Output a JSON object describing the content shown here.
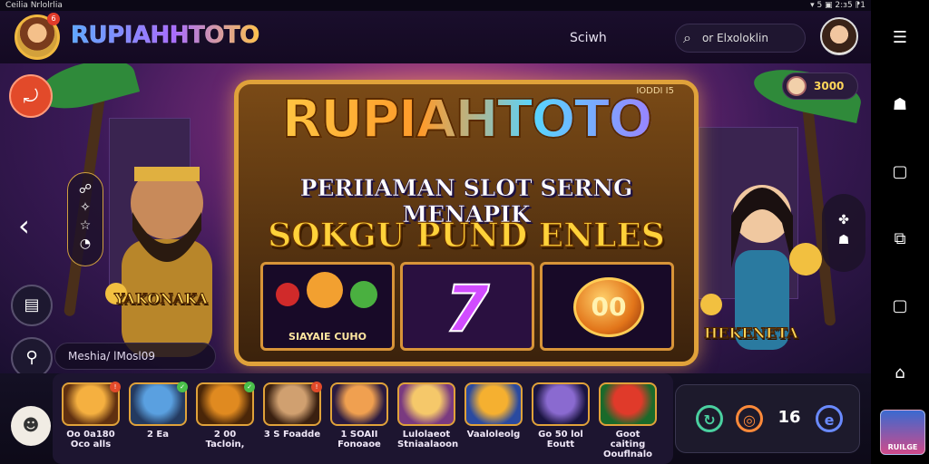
{
  "status_bar": {
    "left_text": "Ceilia Nrlolrlia",
    "right_text": "▾ 5 ▣ 2:ɜ5 ⁋1"
  },
  "header": {
    "logo_text": "RUPIAHHTOTO",
    "logo_badge": "6",
    "search_link": "Sciwh",
    "search_placeholder": "or Elxoloklin"
  },
  "banner": {
    "title": "RUPIAHTOTO",
    "board_tag": "IODDI I5",
    "subtitle1": "PERIIAMAN SLOT SERNG MENAPIK",
    "subtitle2": "SOKGU PUND ENLES",
    "reels": [
      {
        "label": "SIAYAIE CUHO"
      },
      {
        "label": "7"
      },
      {
        "label": "00"
      }
    ],
    "char_left_label": "YAKONAKA",
    "char_right_label": "HEKENETA",
    "coin_amount": "3000",
    "search_strip": "Meshia/ lMosl09",
    "left_panel_icons": [
      "☍",
      "✧",
      "☆",
      "◔"
    ],
    "right_panel_icons": [
      "✤",
      "☗"
    ]
  },
  "games": [
    {
      "name": "Oo 0a180 Oco alls",
      "badge": "!",
      "badge_color": "#e24a2a",
      "colors": [
        "#f5b040",
        "#603010"
      ]
    },
    {
      "name": "2 Ea",
      "badge": "✓",
      "badge_color": "#4ac04a",
      "colors": [
        "#5aa0e0",
        "#243a60"
      ]
    },
    {
      "name": "2 00 Tacloin,",
      "badge": "✓",
      "badge_color": "#4ac04a",
      "colors": [
        "#e08a20",
        "#4a2608"
      ]
    },
    {
      "name": "3 S Foadde",
      "badge": "!",
      "badge_color": "#e24a2a",
      "colors": [
        "#d0a070",
        "#3a2010"
      ]
    },
    {
      "name": "1 SOAII Fonoaoe",
      "badge": "",
      "badge_color": "",
      "colors": [
        "#f0a050",
        "#2a1a40"
      ]
    },
    {
      "name": "Lulolaeot Stniaalaoon",
      "badge": "",
      "badge_color": "",
      "colors": [
        "#f5c86a",
        "#7a3a80"
      ]
    },
    {
      "name": "Vaaloleolg",
      "badge": "",
      "badge_color": "",
      "colors": [
        "#f5b030",
        "#2a4aa0"
      ]
    },
    {
      "name": "Go 50 lol Eoutt",
      "badge": "",
      "badge_color": "",
      "colors": [
        "#8a6ad0",
        "#1a1440"
      ]
    },
    {
      "name": "Goot caiting Oouflnalo",
      "badge": "",
      "badge_color": "",
      "colors": [
        "#e03a2a",
        "#1a6a2a"
      ]
    }
  ],
  "quick_panel": {
    "icons": [
      {
        "name": "refresh-icon",
        "glyph": "↻",
        "color": "#4ad0a0"
      },
      {
        "name": "ring-icon",
        "glyph": "◎",
        "color": "#ff8a3a"
      },
      {
        "name": "counter-icon",
        "glyph": "16",
        "color": "#ffffff"
      },
      {
        "name": "e-icon",
        "glyph": "e",
        "color": "#6a8aff"
      }
    ]
  },
  "sysnav": {
    "icons": [
      "☰",
      "☗",
      "▢",
      "⧉",
      "▢",
      "⌂"
    ],
    "thumb_label": "RUILGE"
  }
}
